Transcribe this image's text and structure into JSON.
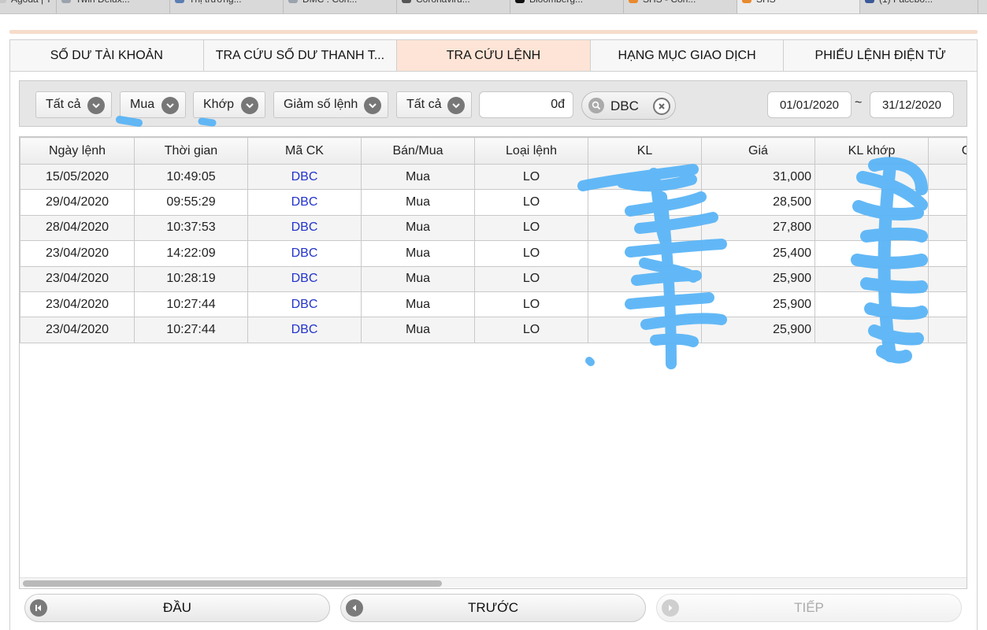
{
  "browser_tabs": [
    {
      "label": "Agoda | T",
      "color": "#c8c8c8"
    },
    {
      "label": "Twin Delux...",
      "color": "#9aa3ad"
    },
    {
      "label": "Thị trường...",
      "color": "#5b7fb3"
    },
    {
      "label": "DMC : Côn...",
      "color": "#9aa3ad"
    },
    {
      "label": "Coronaviru...",
      "color": "#555555"
    },
    {
      "label": "Bloomberg...",
      "color": "#111111"
    },
    {
      "label": "SHS - Côn...",
      "color": "#e98a2e"
    },
    {
      "label": "SHS",
      "color": "#e98a2e"
    },
    {
      "label": "(1) Facebo...",
      "color": "#3b5998"
    }
  ],
  "main_tabs": [
    {
      "label": "SỐ DƯ TÀI KHOẢN",
      "active": false
    },
    {
      "label": "TRA CỨU SỐ DƯ THANH T...",
      "active": false
    },
    {
      "label": "TRA CỨU LỆNH",
      "active": true
    },
    {
      "label": "HẠNG MỤC GIAO DỊCH",
      "active": false
    },
    {
      "label": "PHIẾU LỆNH ĐIỆN TỬ",
      "active": false
    }
  ],
  "filters": {
    "account": "Tất cả",
    "side": "Mua",
    "match_status": "Khớp",
    "sort": "Giảm số lệnh",
    "order_type": "Tất cả",
    "amount": "0đ",
    "symbol": "DBC",
    "date_from": "01/01/2020",
    "date_sep": "~",
    "date_to": "31/12/2020"
  },
  "table": {
    "columns": [
      "Ngày lệnh",
      "Thời gian",
      "Mã CK",
      "Bán/Mua",
      "Loại lệnh",
      "KL",
      "Giá",
      "KL khớp",
      "G"
    ],
    "rows": [
      {
        "date": "15/05/2020",
        "time": "10:49:05",
        "symbol": "DBC",
        "side": "Mua",
        "type": "LO",
        "qty": "",
        "price": "31,000",
        "matched": ""
      },
      {
        "date": "29/04/2020",
        "time": "09:55:29",
        "symbol": "DBC",
        "side": "Mua",
        "type": "LO",
        "qty": "",
        "price": "28,500",
        "matched": ""
      },
      {
        "date": "28/04/2020",
        "time": "10:37:53",
        "symbol": "DBC",
        "side": "Mua",
        "type": "LO",
        "qty": "",
        "price": "27,800",
        "matched": ""
      },
      {
        "date": "23/04/2020",
        "time": "14:22:09",
        "symbol": "DBC",
        "side": "Mua",
        "type": "LO",
        "qty": "",
        "price": "25,400",
        "matched": ""
      },
      {
        "date": "23/04/2020",
        "time": "10:28:19",
        "symbol": "DBC",
        "side": "Mua",
        "type": "LO",
        "qty": "",
        "price": "25,900",
        "matched": ""
      },
      {
        "date": "23/04/2020",
        "time": "10:27:44",
        "symbol": "DBC",
        "side": "Mua",
        "type": "LO",
        "qty": "",
        "price": "25,900",
        "matched": ""
      },
      {
        "date": "23/04/2020",
        "time": "10:27:44",
        "symbol": "DBC",
        "side": "Mua",
        "type": "LO",
        "qty": "",
        "price": "25,900",
        "matched": ""
      }
    ]
  },
  "pager": {
    "first": "ĐẦU",
    "prev": "TRƯỚC",
    "next": "TIẾP"
  },
  "colors": {
    "active_tab": "#fde4d6",
    "link": "#2233cc",
    "redaction": "#5ab4f5"
  }
}
